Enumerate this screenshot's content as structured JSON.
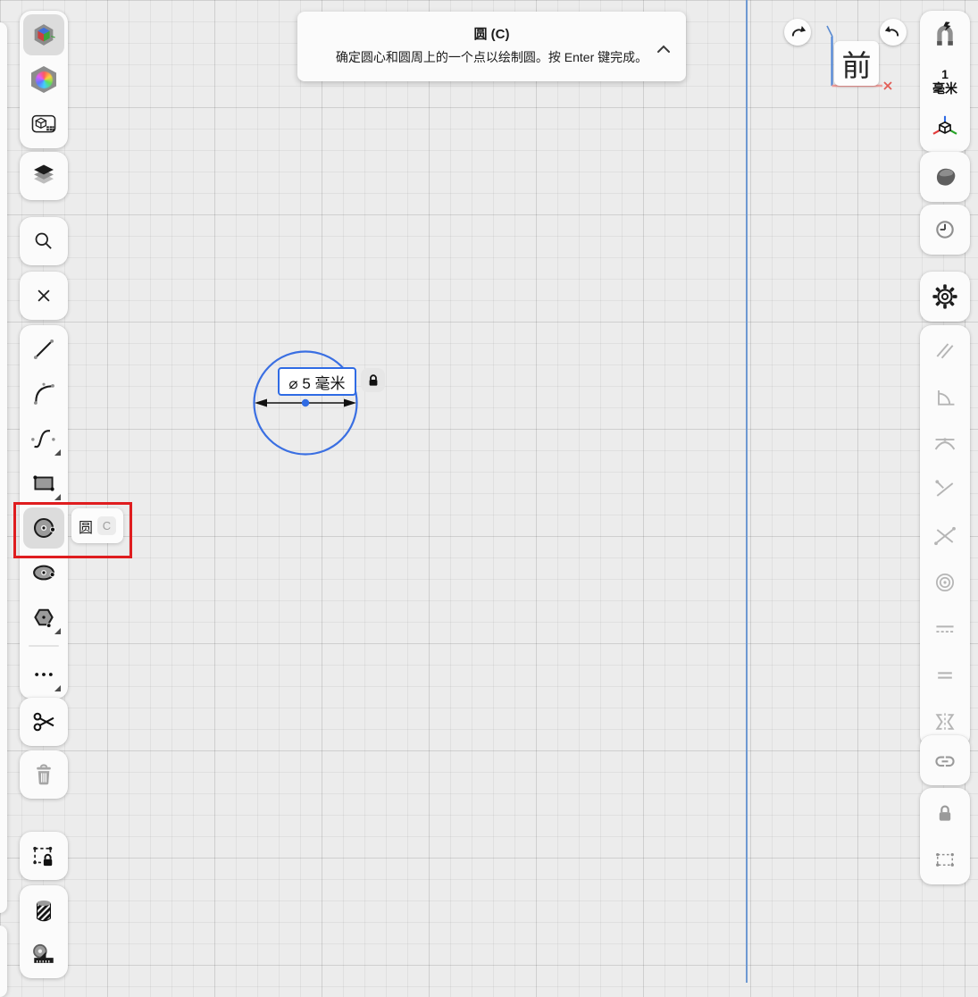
{
  "instruction_banner": {
    "title": "圆 (C)",
    "description": "确定圆心和圆周上的一个点以绘制圆。按 Enter 键完成。",
    "collapse_icon": "chevron-up-icon"
  },
  "tool_flyout": {
    "label": "圆",
    "shortcut": "C"
  },
  "sketch": {
    "shape": "circle",
    "dimension_value": "⌀ 5 毫米",
    "diameter_locked": true
  },
  "view_gizmo": {
    "front_label": "前"
  },
  "right_toolbar": {
    "grid_size_value": "1",
    "grid_size_unit": "毫米",
    "icons": [
      "snap-magnet-icon",
      "origin-axes-icon",
      "shaded-view-icon",
      "history-clock-icon",
      "settings-gear-icon",
      "parallel-constraint-icon",
      "angle-constraint-icon",
      "tangent-constraint-icon",
      "point-on-line-constraint-icon",
      "intersection-constraint-icon",
      "concentric-constraint-icon",
      "collinear-constraint-icon",
      "equal-constraint-icon",
      "symmetry-constraint-icon",
      "unlink-icon",
      "lock-icon",
      "selection-bounds-icon"
    ]
  },
  "left_toolbar": {
    "icons": [
      "orientation-cube-icon",
      "color-wheel-icon",
      "view-settings-icon",
      "layers-icon",
      "search-icon",
      "close-icon",
      "line-tool-icon",
      "arc-tool-icon",
      "spline-tool-icon",
      "rectangle-tool-icon",
      "circle-tool-icon",
      "ellipse-tool-icon",
      "polygon-tool-icon",
      "more-tools-icon",
      "trim-scissors-icon",
      "delete-trash-icon",
      "lock-selection-icon",
      "fill-hatch-icon",
      "measure-tape-icon"
    ],
    "selected_tool": "circle-tool-icon",
    "disabled_tools": [
      "delete-trash-icon"
    ]
  },
  "history_buttons": {
    "left": "redo-arrow-icon",
    "right": "undo-arrow-icon"
  },
  "colors": {
    "canvas_background": "#ececec",
    "grid_line": "#dcdcdc",
    "axis_blue": "#6e99d2",
    "accent_blue": "#2f6be4",
    "sketch_blue": "#3a6fe2",
    "highlight_red": "#df1d1f",
    "gizmo_red": "#f09e9b",
    "disabled_gray": "#b5b5b5"
  }
}
